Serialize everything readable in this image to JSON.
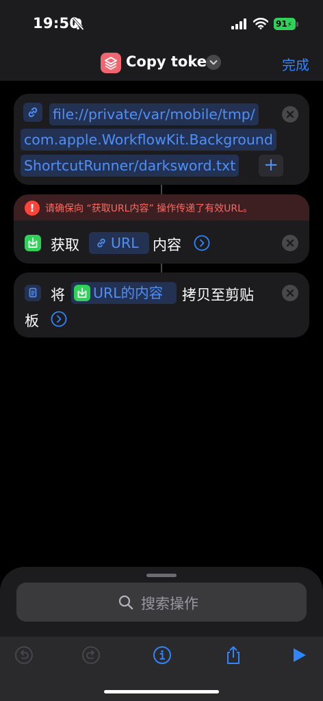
{
  "status_bar": {
    "time": "19:50",
    "battery_level": "91",
    "icons": [
      "bell-slash-icon",
      "cellular-signal-icon",
      "wifi-icon",
      "battery-charging-icon"
    ]
  },
  "nav": {
    "title": "Copy token",
    "done_label": "完成",
    "icons": [
      "shortcuts-app-icon",
      "chevron-down-icon"
    ]
  },
  "actions": [
    {
      "type": "url",
      "url_lines": [
        "file://private/var/mobile/tmp/",
        "com.apple.WorkflowKit.Background",
        "ShortcutRunner/darksword.txt"
      ],
      "add_label": "+"
    },
    {
      "type": "get_contents",
      "warning_icon": "!",
      "warning": "请确保向 “获取URL内容” 操作传递了有效URL。",
      "verb": "获取",
      "param": "URL",
      "suffix": "内容"
    },
    {
      "type": "copy_to_clipboard",
      "verb": "将",
      "param": "URL的内容",
      "suffix_line1": "拷贝至剪贴",
      "suffix_line2": "板"
    }
  ],
  "search": {
    "placeholder": "搜索操作"
  },
  "toolbar": {
    "buttons": [
      "undo-icon",
      "redo-icon",
      "info-icon",
      "share-icon",
      "play-icon"
    ]
  },
  "colors": {
    "accent": "#2f86ff",
    "link_text": "#4f8ff7",
    "warning": "#ff453a",
    "action_green": "#30d158",
    "app_icon": "#f06670",
    "card_bg": "#1c1c1e"
  }
}
